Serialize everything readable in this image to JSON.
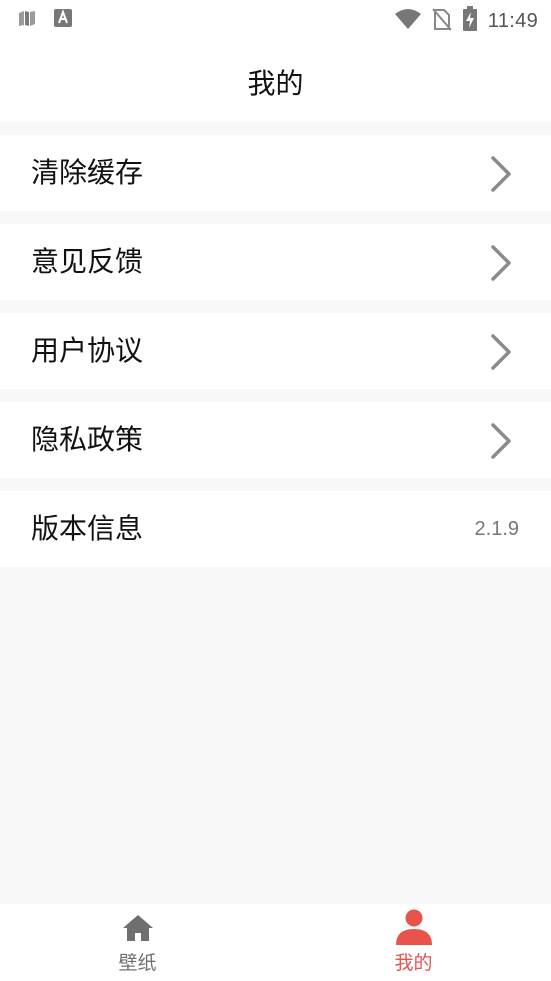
{
  "status_bar": {
    "time": "11:49",
    "left_icons": [
      "sim-card-icon",
      "font-a-icon"
    ],
    "right_icons": [
      "wifi-icon",
      "no-sim-icon",
      "battery-charging-icon"
    ]
  },
  "header": {
    "title": "我的"
  },
  "menu": {
    "items": [
      {
        "label": "清除缓存",
        "icon": "chevron-right-icon"
      },
      {
        "label": "意见反馈",
        "icon": "chevron-right-icon"
      },
      {
        "label": "用户协议",
        "icon": "chevron-right-icon"
      },
      {
        "label": "隐私政策",
        "icon": "chevron-right-icon"
      },
      {
        "label": "版本信息",
        "value": "2.1.9"
      }
    ]
  },
  "tabbar": {
    "tabs": [
      {
        "label": "壁纸",
        "icon": "home-icon",
        "active": false
      },
      {
        "label": "我的",
        "icon": "person-icon",
        "active": true
      }
    ]
  },
  "colors": {
    "accent": "#e8544c",
    "inactive": "#6f6f6f",
    "chevron": "#8a8a8a",
    "page_background": "#f8f8f8"
  }
}
